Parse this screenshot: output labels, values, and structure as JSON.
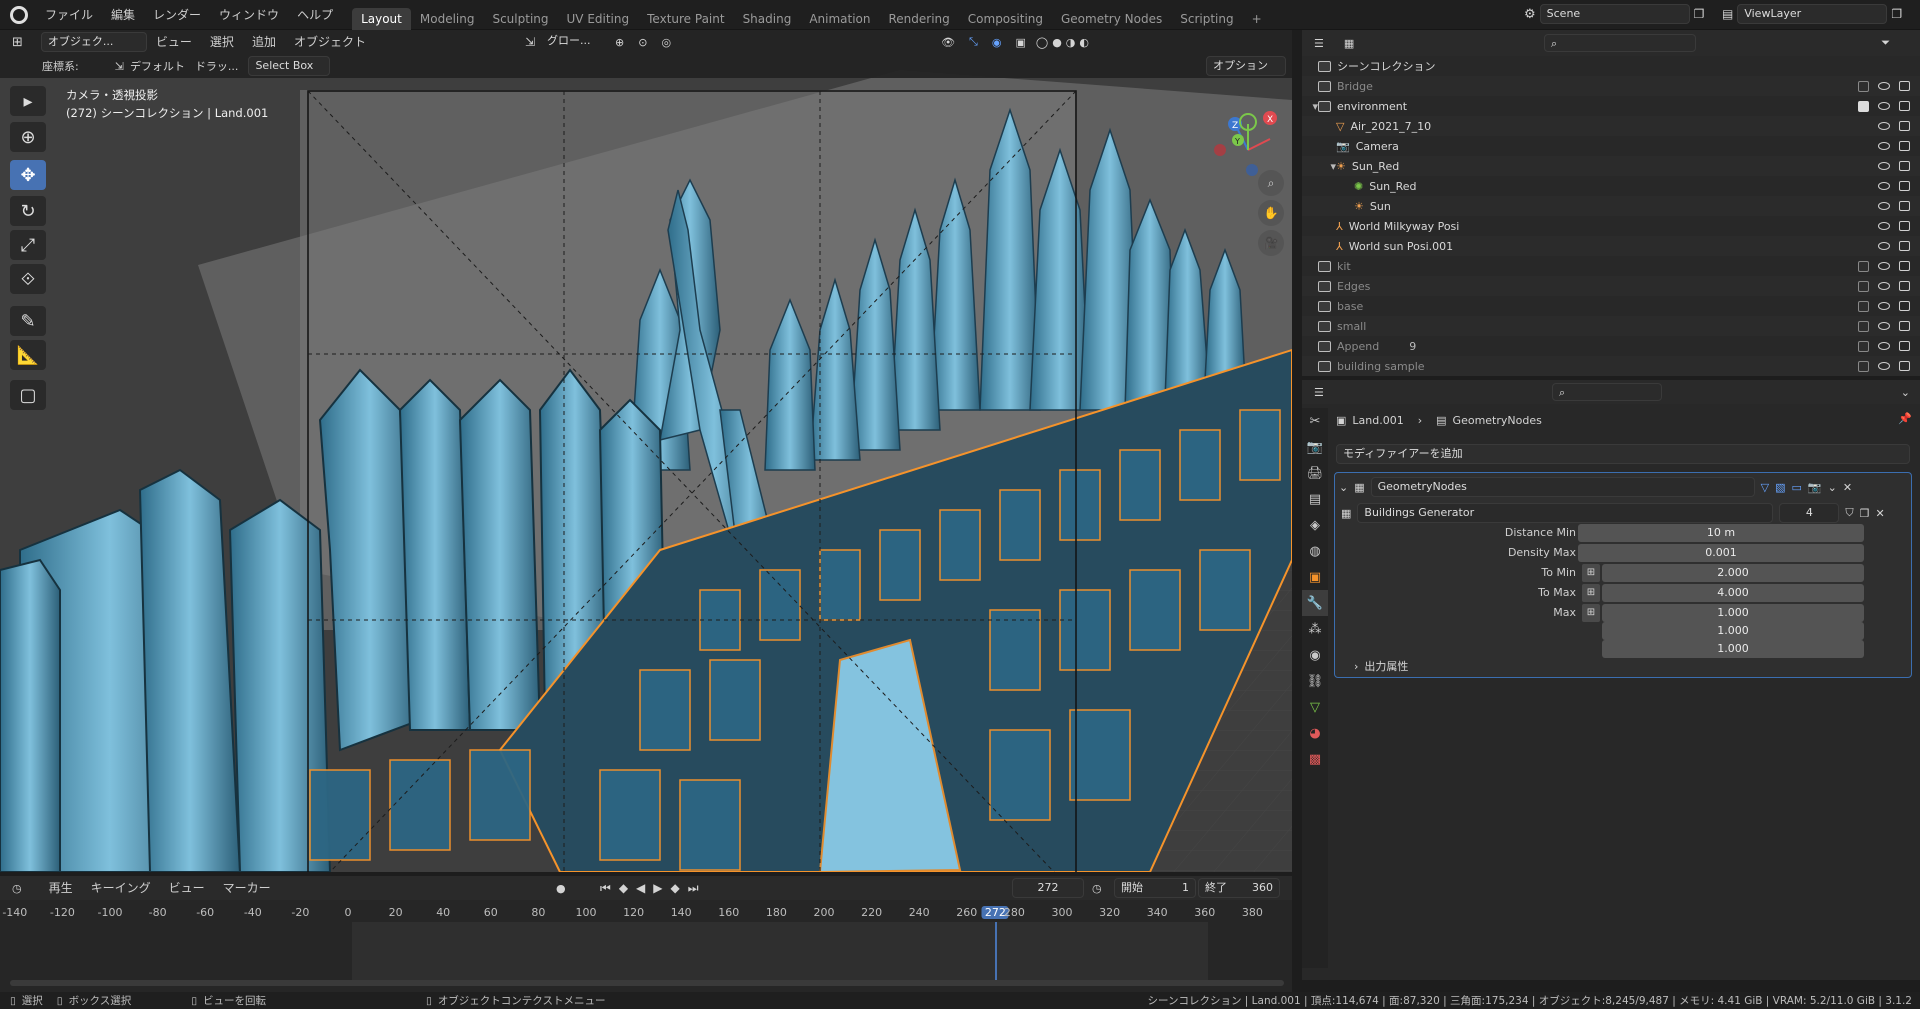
{
  "menubar": {
    "menus": [
      "ファイル",
      "編集",
      "レンダー",
      "ウィンドウ",
      "ヘルプ"
    ],
    "workspaces": [
      "Layout",
      "Modeling",
      "Sculpting",
      "UV Editing",
      "Texture Paint",
      "Shading",
      "Animation",
      "Rendering",
      "Compositing",
      "Geometry Nodes",
      "Scripting"
    ],
    "active_workspace": "Layout",
    "add_tab": "+",
    "scene": "Scene",
    "view_layer": "ViewLayer"
  },
  "viewport": {
    "mode": "オブジェク...",
    "menus": [
      "ビュー",
      "選択",
      "追加",
      "オブジェクト"
    ],
    "transform_orientation": "グロー...",
    "coord_label": "座標系:",
    "coord_value": "デフォルト",
    "drag_label": "ドラッ...",
    "select_box": "Select Box",
    "options": "オプション",
    "info_line1": "カメラ・透視投影",
    "info_line2": "(272) シーンコレクション | Land.001",
    "accent_color": "#4772b3",
    "selection_color": "#f5932b"
  },
  "outliner": {
    "search_placeholder": "",
    "root": "シーンコレクション",
    "rows": [
      {
        "label": "Bridge",
        "indent": 1,
        "kind": "collection",
        "dim": true,
        "checked": false
      },
      {
        "label": "environment",
        "indent": 1,
        "kind": "collection",
        "dim": false,
        "checked": true,
        "expanded": true
      },
      {
        "label": "Air_2021_7_10",
        "indent": 2,
        "kind": "object",
        "dim": false
      },
      {
        "label": "Camera",
        "indent": 2,
        "kind": "camera",
        "dim": false
      },
      {
        "label": "Sun_Red",
        "indent": 2,
        "kind": "light",
        "dim": false,
        "expanded": true
      },
      {
        "label": "Sun_Red",
        "indent": 3,
        "kind": "light-data",
        "dim": false
      },
      {
        "label": "Sun",
        "indent": 3,
        "kind": "light",
        "dim": false
      },
      {
        "label": "World Milkyway Posi",
        "indent": 2,
        "kind": "empty",
        "dim": false
      },
      {
        "label": "World sun Posi.001",
        "indent": 2,
        "kind": "empty",
        "dim": false
      },
      {
        "label": "kit",
        "indent": 1,
        "kind": "collection",
        "dim": true,
        "checked": false
      },
      {
        "label": "Edges",
        "indent": 1,
        "kind": "collection",
        "dim": true,
        "checked": false
      },
      {
        "label": "base",
        "indent": 1,
        "kind": "collection",
        "dim": true,
        "checked": false
      },
      {
        "label": "small",
        "indent": 1,
        "kind": "collection",
        "dim": true,
        "checked": false
      },
      {
        "label": "Append",
        "indent": 1,
        "kind": "collection",
        "dim": true,
        "checked": false,
        "badge": "9"
      },
      {
        "label": "building sample",
        "indent": 1,
        "kind": "collection",
        "dim": true,
        "checked": false
      }
    ]
  },
  "properties": {
    "breadcrumb_object": "Land.001",
    "breadcrumb_modifier": "GeometryNodes",
    "add_modifier": "モディファイアーを追加",
    "modifier_name": "GeometryNodes",
    "node_group": "Buildings Generator",
    "node_users": "4",
    "fields": [
      {
        "label": "Distance Min",
        "value": "10 m"
      },
      {
        "label": "Density Max",
        "value": "0.001"
      },
      {
        "label": "To Min",
        "value": "2.000"
      },
      {
        "label": "To Max",
        "value": "4.000"
      },
      {
        "label": "Max",
        "value": "1.000"
      },
      {
        "label": "",
        "value": "1.000"
      },
      {
        "label": "",
        "value": "1.000"
      }
    ],
    "output_attrs": "出力属性"
  },
  "timeline": {
    "menus": [
      "再生",
      "キーイング",
      "ビュー",
      "マーカー"
    ],
    "current_frame": "272",
    "start_label": "開始",
    "start": "1",
    "end_label": "終了",
    "end": "360",
    "ticks": [
      "-140",
      "-120",
      "-100",
      "-80",
      "-60",
      "-40",
      "-20",
      "0",
      "20",
      "40",
      "60",
      "80",
      "100",
      "120",
      "140",
      "160",
      "180",
      "200",
      "220",
      "240",
      "260",
      "272",
      "280",
      "300",
      "320",
      "340",
      "360",
      "380"
    ]
  },
  "statusbar": {
    "select": "選択",
    "box_select": "ボックス選択",
    "rotate_view": "ビューを回転",
    "context_menu": "オブジェクトコンテクストメニュー",
    "stats": "シーンコレクション | Land.001 | 頂点:114,674 | 面:87,320 | 三角面:175,234 | オブジェクト:8,245/9,487 | メモリ: 4.41 GiB | VRAM: 5.2/11.0 GiB | 3.1.2"
  }
}
